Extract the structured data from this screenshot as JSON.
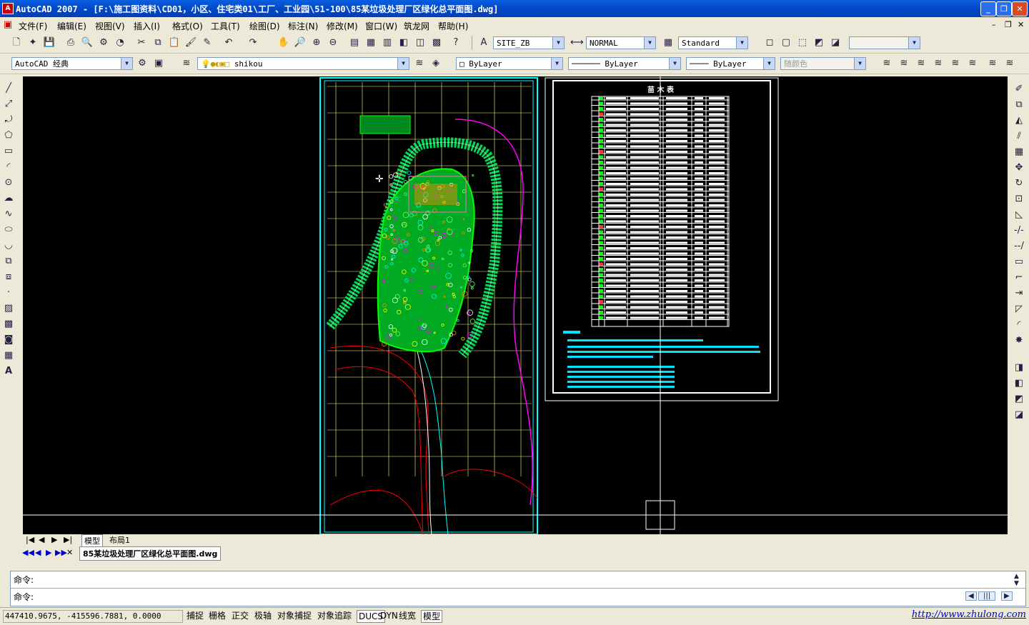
{
  "window": {
    "title": "AutoCAD 2007 - [F:\\施工图资料\\CD01，小区、住宅类01\\工厂、工业园\\51-100\\85某垃圾处理厂区绿化总平面图.dwg]",
    "logo_icon": "autocad-logo-icon",
    "minimize_icon": "minimize-icon",
    "restore_icon": "restore-icon",
    "close_icon": "close-icon"
  },
  "menu": {
    "items": [
      "文件(F)",
      "编辑(E)",
      "视图(V)",
      "插入(I)",
      "格式(O)",
      "工具(T)",
      "绘图(D)",
      "标注(N)",
      "修改(M)",
      "窗口(W)",
      "筑龙网",
      "帮助(H)"
    ]
  },
  "toolbar_styles": {
    "text_style": "SITE_ZB",
    "dim_style": "NORMAL",
    "table_style": "Standard"
  },
  "toolbar_layers": {
    "workspace": "AutoCAD 经典",
    "layer": "shikou",
    "color": "ByLayer",
    "linetype": "ByLayer",
    "lineweight": "ByLayer",
    "plotstyle": "随颜色"
  },
  "drawing": {
    "table_title": "苗 木 表",
    "background": "#000000",
    "accent_colors": {
      "grid": "#ffff80",
      "frame": "#00ffff",
      "plants": "#00ff00",
      "road": "#ff00ff",
      "boundary": "#ff0000"
    }
  },
  "layout_tabs": [
    "模型",
    "布局1"
  ],
  "document_tab": "85某垃圾处理厂区绿化总平面图.dwg",
  "command": {
    "line1": "命令:",
    "line2": "命令:"
  },
  "status": {
    "coordinates": "447410.9675, -415596.7881, 0.0000",
    "buttons": [
      "捕捉",
      "栅格",
      "正交",
      "极轴",
      "对象捕捉",
      "对象追踪",
      "DUCS",
      "DYN",
      "线宽",
      "模型"
    ],
    "website": "http://www.zhulong.com"
  }
}
